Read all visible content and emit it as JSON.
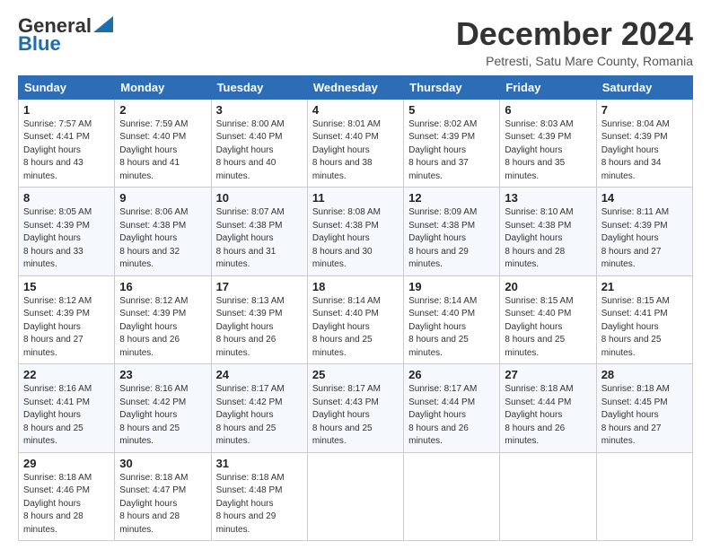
{
  "logo": {
    "line1": "General",
    "line2": "Blue"
  },
  "header": {
    "month": "December 2024",
    "location": "Petresti, Satu Mare County, Romania"
  },
  "weekdays": [
    "Sunday",
    "Monday",
    "Tuesday",
    "Wednesday",
    "Thursday",
    "Friday",
    "Saturday"
  ],
  "weeks": [
    [
      {
        "day": "1",
        "sunrise": "7:57 AM",
        "sunset": "4:41 PM",
        "daylight": "8 hours and 43 minutes."
      },
      {
        "day": "2",
        "sunrise": "7:59 AM",
        "sunset": "4:40 PM",
        "daylight": "8 hours and 41 minutes."
      },
      {
        "day": "3",
        "sunrise": "8:00 AM",
        "sunset": "4:40 PM",
        "daylight": "8 hours and 40 minutes."
      },
      {
        "day": "4",
        "sunrise": "8:01 AM",
        "sunset": "4:40 PM",
        "daylight": "8 hours and 38 minutes."
      },
      {
        "day": "5",
        "sunrise": "8:02 AM",
        "sunset": "4:39 PM",
        "daylight": "8 hours and 37 minutes."
      },
      {
        "day": "6",
        "sunrise": "8:03 AM",
        "sunset": "4:39 PM",
        "daylight": "8 hours and 35 minutes."
      },
      {
        "day": "7",
        "sunrise": "8:04 AM",
        "sunset": "4:39 PM",
        "daylight": "8 hours and 34 minutes."
      }
    ],
    [
      {
        "day": "8",
        "sunrise": "8:05 AM",
        "sunset": "4:39 PM",
        "daylight": "8 hours and 33 minutes."
      },
      {
        "day": "9",
        "sunrise": "8:06 AM",
        "sunset": "4:38 PM",
        "daylight": "8 hours and 32 minutes."
      },
      {
        "day": "10",
        "sunrise": "8:07 AM",
        "sunset": "4:38 PM",
        "daylight": "8 hours and 31 minutes."
      },
      {
        "day": "11",
        "sunrise": "8:08 AM",
        "sunset": "4:38 PM",
        "daylight": "8 hours and 30 minutes."
      },
      {
        "day": "12",
        "sunrise": "8:09 AM",
        "sunset": "4:38 PM",
        "daylight": "8 hours and 29 minutes."
      },
      {
        "day": "13",
        "sunrise": "8:10 AM",
        "sunset": "4:38 PM",
        "daylight": "8 hours and 28 minutes."
      },
      {
        "day": "14",
        "sunrise": "8:11 AM",
        "sunset": "4:39 PM",
        "daylight": "8 hours and 27 minutes."
      }
    ],
    [
      {
        "day": "15",
        "sunrise": "8:12 AM",
        "sunset": "4:39 PM",
        "daylight": "8 hours and 27 minutes."
      },
      {
        "day": "16",
        "sunrise": "8:12 AM",
        "sunset": "4:39 PM",
        "daylight": "8 hours and 26 minutes."
      },
      {
        "day": "17",
        "sunrise": "8:13 AM",
        "sunset": "4:39 PM",
        "daylight": "8 hours and 26 minutes."
      },
      {
        "day": "18",
        "sunrise": "8:14 AM",
        "sunset": "4:40 PM",
        "daylight": "8 hours and 25 minutes."
      },
      {
        "day": "19",
        "sunrise": "8:14 AM",
        "sunset": "4:40 PM",
        "daylight": "8 hours and 25 minutes."
      },
      {
        "day": "20",
        "sunrise": "8:15 AM",
        "sunset": "4:40 PM",
        "daylight": "8 hours and 25 minutes."
      },
      {
        "day": "21",
        "sunrise": "8:15 AM",
        "sunset": "4:41 PM",
        "daylight": "8 hours and 25 minutes."
      }
    ],
    [
      {
        "day": "22",
        "sunrise": "8:16 AM",
        "sunset": "4:41 PM",
        "daylight": "8 hours and 25 minutes."
      },
      {
        "day": "23",
        "sunrise": "8:16 AM",
        "sunset": "4:42 PM",
        "daylight": "8 hours and 25 minutes."
      },
      {
        "day": "24",
        "sunrise": "8:17 AM",
        "sunset": "4:42 PM",
        "daylight": "8 hours and 25 minutes."
      },
      {
        "day": "25",
        "sunrise": "8:17 AM",
        "sunset": "4:43 PM",
        "daylight": "8 hours and 25 minutes."
      },
      {
        "day": "26",
        "sunrise": "8:17 AM",
        "sunset": "4:44 PM",
        "daylight": "8 hours and 26 minutes."
      },
      {
        "day": "27",
        "sunrise": "8:18 AM",
        "sunset": "4:44 PM",
        "daylight": "8 hours and 26 minutes."
      },
      {
        "day": "28",
        "sunrise": "8:18 AM",
        "sunset": "4:45 PM",
        "daylight": "8 hours and 27 minutes."
      }
    ],
    [
      {
        "day": "29",
        "sunrise": "8:18 AM",
        "sunset": "4:46 PM",
        "daylight": "8 hours and 28 minutes."
      },
      {
        "day": "30",
        "sunrise": "8:18 AM",
        "sunset": "4:47 PM",
        "daylight": "8 hours and 28 minutes."
      },
      {
        "day": "31",
        "sunrise": "8:18 AM",
        "sunset": "4:48 PM",
        "daylight": "8 hours and 29 minutes."
      },
      null,
      null,
      null,
      null
    ]
  ]
}
